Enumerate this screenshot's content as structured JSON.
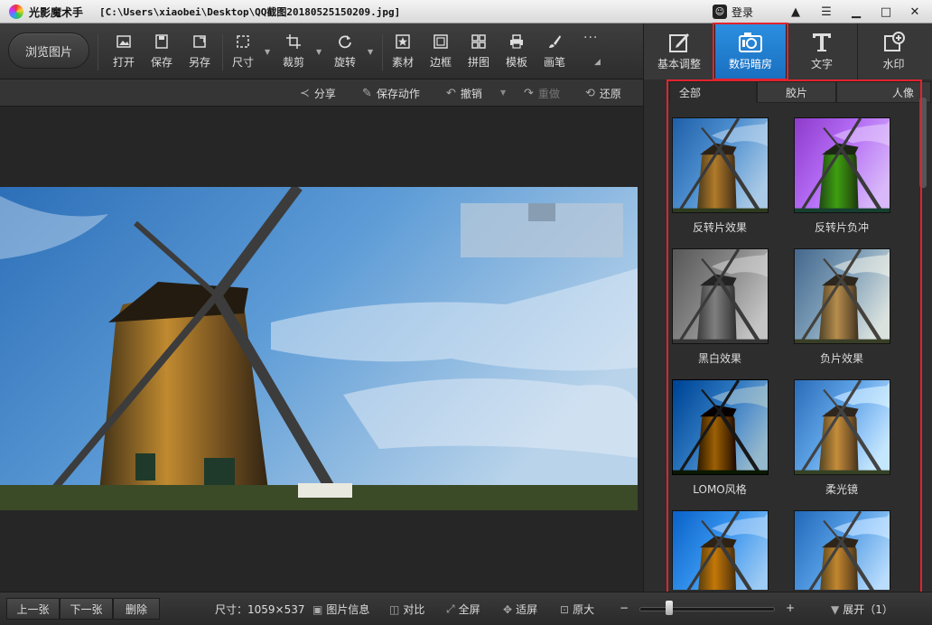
{
  "window": {
    "app_name": "光影魔术手",
    "file_path": "[C:\\Users\\xiaobei\\Desktop\\QQ截图20180525150209.jpg]",
    "login": "登录"
  },
  "toolbar": {
    "browse": "浏览图片",
    "tools": [
      "打开",
      "保存",
      "另存",
      "尺寸",
      "裁剪",
      "旋转",
      "素材",
      "边框",
      "拼图",
      "模板",
      "画笔"
    ]
  },
  "subbar": {
    "share": "分享",
    "save_action": "保存动作",
    "undo": "撤销",
    "redo": "重做",
    "restore": "还原"
  },
  "right_tabs": [
    "基本调整",
    "数码暗房",
    "文字",
    "水印"
  ],
  "active_right_tab": "数码暗房",
  "filter_tabs": [
    "全部",
    "胶片",
    "人像"
  ],
  "active_filter_tab": "全部",
  "filters": [
    "反转片效果",
    "反转片负冲",
    "黑白效果",
    "负片效果",
    "LOMO风格",
    "柔光镜",
    "",
    ""
  ],
  "bottom": {
    "prev": "上一张",
    "next": "下一张",
    "delete": "删除",
    "size_label": "尺寸：1059×537",
    "info": "图片信息",
    "compare": "对比",
    "fullscreen": "全屏",
    "fit": "适屏",
    "original": "原大",
    "zoom_minus": "−",
    "zoom_plus": "+",
    "expand": "展开（1）",
    "zoom_level": 0.2
  },
  "colors": {
    "accent": "#1a6fc0",
    "highlight": "#e0242e"
  }
}
